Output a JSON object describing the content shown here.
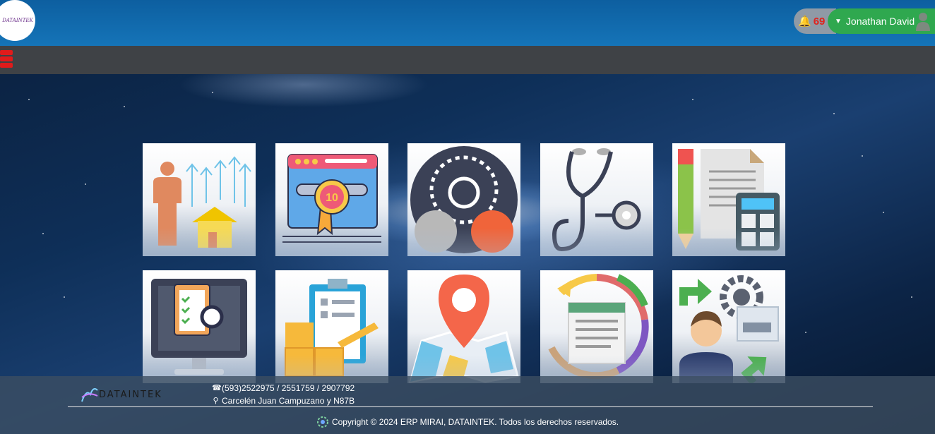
{
  "header": {
    "logo_text": "DATAINTEK",
    "notifications_count": "69",
    "user_name": "Jonathan David"
  },
  "modules": [
    {
      "icon": "human-resources-icon"
    },
    {
      "icon": "quality-badge-icon"
    },
    {
      "icon": "settings-gears-icon"
    },
    {
      "icon": "medical-stethoscope-icon"
    },
    {
      "icon": "accounting-calculator-icon"
    },
    {
      "icon": "task-checklist-monitor-icon"
    },
    {
      "icon": "inventory-clipboard-boxes-icon"
    },
    {
      "icon": "map-location-icon"
    },
    {
      "icon": "document-sync-cycle-icon"
    },
    {
      "icon": "workflow-process-icon"
    }
  ],
  "footer": {
    "brand": "DATAINTEK",
    "phone": "(593)2522975 / 2551759 / 2907792",
    "address": "Carcelén Juan Campuzano y N87B",
    "copyright": "Copyright © 2024 ERP MIRAI, DATAINTEK. Todos los derechos reservados."
  },
  "colors": {
    "header_bg": "#1574b8",
    "strip_bg": "#3f4246",
    "user_button": "#2fa84f",
    "notification_count": "#e0231d",
    "menu_toggle": "#e01b1b"
  }
}
